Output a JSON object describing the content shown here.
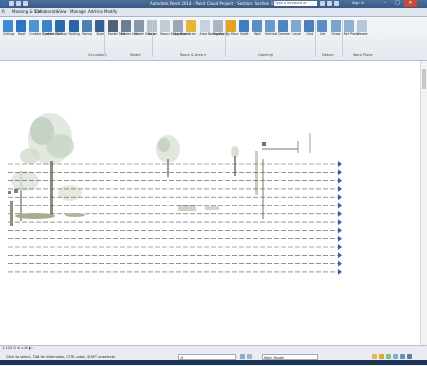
{
  "window": {
    "title": "Autodesk Revit 2014 - Point Cloud Project - Section: Section 1",
    "search_placeholder": "Type a keyword or phrase",
    "signin": "Sign In",
    "min": "–",
    "max": "□",
    "close": "✕"
  },
  "tabs": [
    "R",
    "Massing & Site",
    "Collaborate",
    "View",
    "Manage",
    "Add-Ins",
    "Modify"
  ],
  "ribbon": {
    "buttons": [
      {
        "label": "Ceiling",
        "color": "#3f8bd1"
      },
      {
        "label": "Roof",
        "color": "#2f74c0"
      },
      {
        "label": "Curtain System",
        "color": "#4a96d8"
      },
      {
        "label": "Curtain Grid",
        "color": "#3d83c9"
      },
      {
        "label": "Mullion",
        "color": "#2d6aad"
      },
      {
        "label": "Railing",
        "color": "#2a64a6"
      },
      {
        "label": "Ramp",
        "color": "#4e80b4"
      },
      {
        "label": "Stair",
        "color": "#355f8f"
      },
      {
        "label": "Model Text",
        "color": "#4f6172"
      },
      {
        "label": "Model Line",
        "color": "#6b7f93"
      },
      {
        "label": "Model Group",
        "color": "#8597a9"
      },
      {
        "label": "Room",
        "color": "#b7c2cd"
      },
      {
        "label": "Room Separator",
        "color": "#c3ccd6"
      },
      {
        "label": "Tag Room",
        "color": "#9aa7b5"
      },
      {
        "label": "Area",
        "color": "#e5b53a"
      },
      {
        "label": "Area Boundary",
        "color": "#c9d2dc"
      },
      {
        "label": "Tag Area",
        "color": "#a9b5c2"
      },
      {
        "label": "By Face",
        "color": "#e0a423"
      },
      {
        "label": "Shaft",
        "color": "#3f7dbd"
      },
      {
        "label": "Wall",
        "color": "#5b8ec2"
      },
      {
        "label": "Vertical",
        "color": "#6a9acb"
      },
      {
        "label": "Dormer",
        "color": "#4f86bf"
      },
      {
        "label": "Level",
        "color": "#7fa6cf"
      },
      {
        "label": "Grid",
        "color": "#4b7fb6"
      },
      {
        "label": "Set",
        "color": "#5a8dc3"
      },
      {
        "label": "Show",
        "color": "#7aa2cc"
      },
      {
        "label": "Ref Plane",
        "color": "#8eb1d6"
      },
      {
        "label": "Viewer",
        "color": "#b8c7d6"
      }
    ],
    "panels": [
      "Circulation",
      "Model",
      "Room & Area ▾",
      "Opening",
      "Datum",
      "Work Plane"
    ]
  },
  "canvas": {
    "tag_text": "Section"
  },
  "status": {
    "view_controls": "1:100  ⊡ ⊕ ⌂ ⊞ ◐ ‹",
    "message": "Click to select, TAB for alternates, CTRL adds, SHIFT unselects.",
    "workset": ":0",
    "model": "Main Model"
  }
}
